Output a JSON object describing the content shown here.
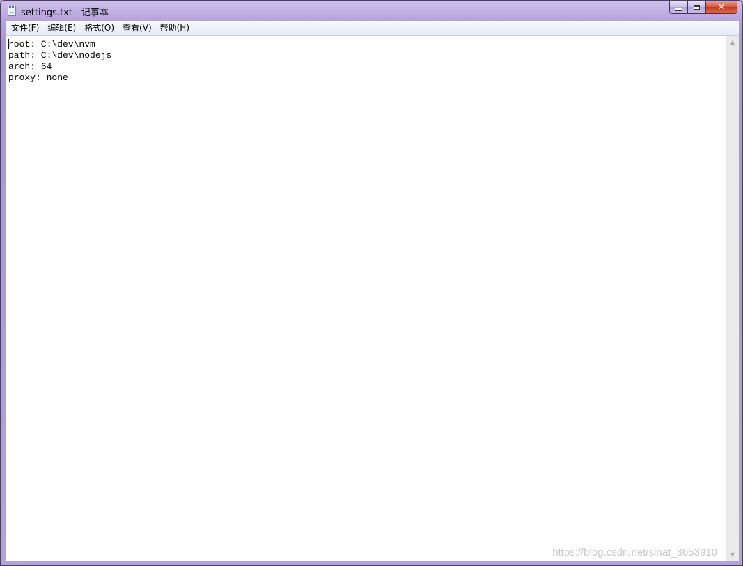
{
  "window": {
    "title": "settings.txt - 记事本"
  },
  "caption_buttons": {
    "minimize_icon": "minimize-icon",
    "maximize_icon": "maximize-icon",
    "close_icon": "close-icon",
    "close_glyph": "✕"
  },
  "menu": {
    "items": [
      {
        "label": "文件(F)"
      },
      {
        "label": "编辑(E)"
      },
      {
        "label": "格式(O)"
      },
      {
        "label": "查看(V)"
      },
      {
        "label": "帮助(H)"
      }
    ]
  },
  "editor": {
    "lines": [
      "root: C:\\dev\\nvm",
      "path: C:\\dev\\nodejs",
      "arch: 64",
      "proxy: none"
    ]
  },
  "scrollbar": {
    "up_glyph": "▲",
    "down_glyph": "▼"
  },
  "watermark": "https://blog.csdn.net/sinat_3653910"
}
